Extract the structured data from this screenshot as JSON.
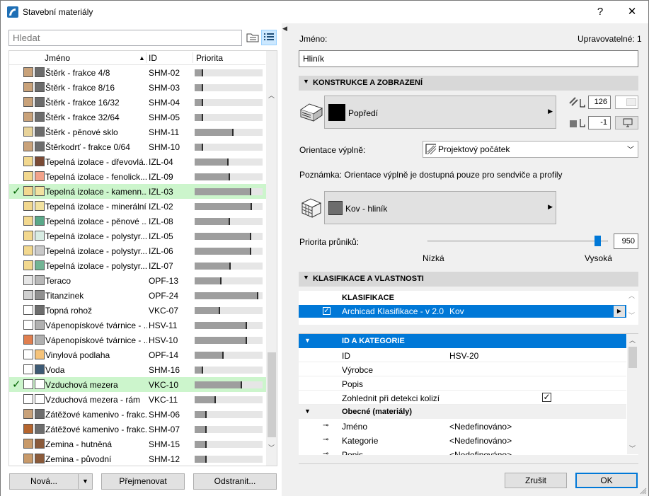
{
  "window": {
    "title": "Stavební materiály",
    "help": "?",
    "close": "✕"
  },
  "search": {
    "placeholder": "Hledat"
  },
  "list": {
    "headers": {
      "name": "Jméno",
      "id": "ID",
      "priority": "Priorita"
    },
    "rows": [
      {
        "name": "Štěrk - frakce 4/8",
        "id": "SHM-02",
        "priority": 0.13,
        "sel": false,
        "c1": "#c9a27a",
        "c2": "#6d6d6d"
      },
      {
        "name": "Štěrk - frakce 8/16",
        "id": "SHM-03",
        "priority": 0.13,
        "sel": false,
        "c1": "#c9a27a",
        "c2": "#6d6d6d"
      },
      {
        "name": "Štěrk - frakce 16/32",
        "id": "SHM-04",
        "priority": 0.13,
        "sel": false,
        "c1": "#c9a27a",
        "c2": "#6d6d6d"
      },
      {
        "name": "Štěrk - frakce 32/64",
        "id": "SHM-05",
        "priority": 0.13,
        "sel": false,
        "c1": "#c9a27a",
        "c2": "#6d6d6d"
      },
      {
        "name": "Štěrk - pěnové sklo",
        "id": "SHM-11",
        "priority": 0.57,
        "sel": false,
        "c1": "#e8d39a",
        "c2": "#6d6d6d"
      },
      {
        "name": "Štěrkodrť - frakce 0/64",
        "id": "SHM-10",
        "priority": 0.13,
        "sel": false,
        "c1": "#c9a27a",
        "c2": "#6d6d6d"
      },
      {
        "name": "Tepelná izolace - dřevovlá...",
        "id": "IZL-04",
        "priority": 0.5,
        "sel": false,
        "c1": "#f2d88f",
        "c2": "#7a4a35"
      },
      {
        "name": "Tepelná izolace - fenolick...",
        "id": "IZL-09",
        "priority": 0.52,
        "sel": false,
        "c1": "#f2d88f",
        "c2": "#f2a28a"
      },
      {
        "name": "Tepelná izolace - kamenn...",
        "id": "IZL-03",
        "priority": 0.83,
        "sel": true,
        "c1": "#f2d88f",
        "c2": "#f2e2a0"
      },
      {
        "name": "Tepelná izolace - minerální...",
        "id": "IZL-02",
        "priority": 0.84,
        "sel": false,
        "c1": "#f2d88f",
        "c2": "#f2e2a0"
      },
      {
        "name": "Tepelná izolace - pěnové ...",
        "id": "IZL-08",
        "priority": 0.52,
        "sel": false,
        "c1": "#f2d88f",
        "c2": "#5aa889"
      },
      {
        "name": "Tepelná izolace - polystyr...",
        "id": "IZL-05",
        "priority": 0.83,
        "sel": false,
        "c1": "#f2d88f",
        "c2": "#d8ece3"
      },
      {
        "name": "Tepelná izolace - polystyr...",
        "id": "IZL-06",
        "priority": 0.83,
        "sel": false,
        "c1": "#f2d88f",
        "c2": "#c9c9c9"
      },
      {
        "name": "Tepelná izolace - polystyr...",
        "id": "IZL-07",
        "priority": 0.53,
        "sel": false,
        "c1": "#f2d88f",
        "c2": "#72b494"
      },
      {
        "name": "Teraco",
        "id": "OPF-13",
        "priority": 0.4,
        "sel": false,
        "c1": "#e6e6e6",
        "c2": "#b8b8b8"
      },
      {
        "name": "Titanzinek",
        "id": "OPF-24",
        "priority": 0.94,
        "sel": false,
        "c1": "#d0d0d0",
        "c2": "#909090"
      },
      {
        "name": "Topná rohož",
        "id": "VKC-07",
        "priority": 0.37,
        "sel": false,
        "c1": "#ffffff",
        "c2": "#6d6d6d"
      },
      {
        "name": "Vápenopískové tvárnice - ...",
        "id": "HSV-11",
        "priority": 0.77,
        "sel": false,
        "c1": "#ffffff",
        "c2": "#b0b0b0"
      },
      {
        "name": "Vápenopískové tvárnice - ...",
        "id": "HSV-10",
        "priority": 0.77,
        "sel": false,
        "c1": "#e07f4f",
        "c2": "#b0b0b0"
      },
      {
        "name": "Vinylová podlaha",
        "id": "OPF-14",
        "priority": 0.43,
        "sel": false,
        "c1": "#ffffff",
        "c2": "#f5c37a"
      },
      {
        "name": "Voda",
        "id": "SHM-16",
        "priority": 0.12,
        "sel": false,
        "c1": "#ffffff",
        "c2": "#3d5a74"
      },
      {
        "name": "Vzduchová mezera",
        "id": "VKC-10",
        "priority": 0.7,
        "sel": true,
        "c1": "#ffffff",
        "c2": "#ffffff"
      },
      {
        "name": "Vzduchová mezera - rám",
        "id": "VKC-11",
        "priority": 0.31,
        "sel": false,
        "c1": "#ffffff",
        "c2": "#ffffff"
      },
      {
        "name": "Zátěžové kamenivo - frakc...",
        "id": "SHM-06",
        "priority": 0.18,
        "sel": false,
        "c1": "#c9a27a",
        "c2": "#6d6d6d"
      },
      {
        "name": "Zátěžové kamenivo - frakc...",
        "id": "SHM-07",
        "priority": 0.18,
        "sel": false,
        "c1": "#b5652e",
        "c2": "#6d6d6d"
      },
      {
        "name": "Zemina - hutněná",
        "id": "SHM-15",
        "priority": 0.18,
        "sel": false,
        "c1": "#c89a6a",
        "c2": "#8a5a3a"
      },
      {
        "name": "Zemina - původní",
        "id": "SHM-12",
        "priority": 0.18,
        "sel": false,
        "c1": "#c89a6a",
        "c2": "#8a5a3a"
      }
    ]
  },
  "buttons": {
    "new": "Nová...",
    "rename": "Přejmenovat",
    "delete": "Odstranit...",
    "cancel": "Zrušit",
    "ok": "OK"
  },
  "props": {
    "name_label": "Jméno:",
    "editable": "Upravovatelné: 1",
    "name_value": "Hliník",
    "section1": "KONSTRUKCE A ZOBRAZENÍ",
    "foreground": "Popředí",
    "pen1": "126",
    "pen2": "-1",
    "orientation_label": "Orientace výplně:",
    "orientation_value": "Projektový počátek",
    "note": "Poznámka: Orientace výplně je dostupná pouze pro sendviče a profily",
    "surface": "Kov - hliník",
    "priority_label": "Priorita průniků:",
    "priority_value": "950",
    "priority_fraction": 0.96,
    "low": "Nízká",
    "high": "Vysoká",
    "section2": "KLASIFIKACE A VLASTNOSTI",
    "classification_header": "KLASIFIKACE",
    "classification_name": "Archicad Klasifikace - v 2.0",
    "classification_value": "Kov",
    "id_section": "ID A KATEGORIE",
    "fields": [
      {
        "label": "ID",
        "value": "HSV-20"
      },
      {
        "label": "Výrobce",
        "value": ""
      },
      {
        "label": "Popis",
        "value": ""
      },
      {
        "label": "Zohlednit při detekci kolizí",
        "value": "✓"
      }
    ],
    "general_section": "Obecné (materiály)",
    "general_fields": [
      {
        "label": "Jméno",
        "value": "<Nedefinováno>"
      },
      {
        "label": "Kategorie",
        "value": "<Nedefinováno>"
      },
      {
        "label": "Popis",
        "value": "<Nedefinováno>"
      }
    ]
  },
  "colors": {
    "accent": "#0078d7",
    "selection": "#ccf5cc",
    "section": "#d8d8d8"
  }
}
